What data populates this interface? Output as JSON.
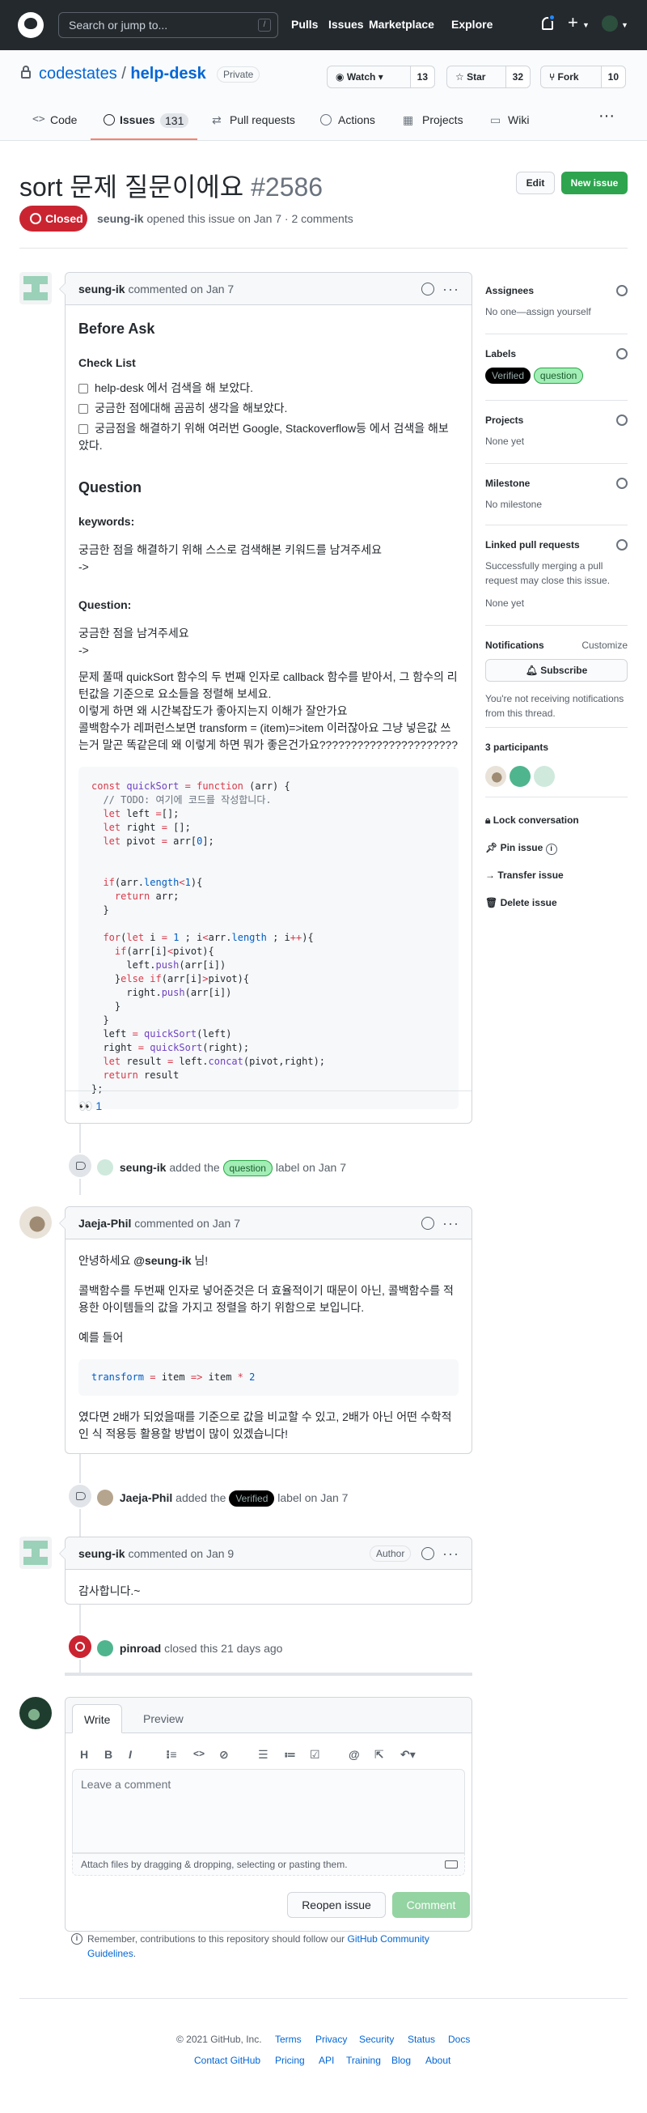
{
  "header": {
    "search_placeholder": "Search or jump to...",
    "slash_key": "/",
    "nav": [
      "Pulls",
      "Issues",
      "Marketplace",
      "Explore"
    ],
    "plus": "+"
  },
  "repo": {
    "owner": "codestates",
    "separator": "/",
    "name": "help-desk",
    "visibility": "Private",
    "watch_label": "Watch",
    "watch_count": "13",
    "star_label": "Star",
    "star_count": "32",
    "fork_label": "Fork",
    "fork_count": "10"
  },
  "tabs": [
    {
      "label": "Code"
    },
    {
      "label": "Issues",
      "count": "131"
    },
    {
      "label": "Pull requests"
    },
    {
      "label": "Actions"
    },
    {
      "label": "Projects"
    },
    {
      "label": "Wiki"
    }
  ],
  "issue": {
    "title": "sort 문제 질문이에요",
    "number": "#2586",
    "edit_label": "Edit",
    "new_issue_label": "New issue",
    "state": "Closed",
    "author": "seung-ik",
    "meta_text": "opened this issue on Jan 7 · 2 comments"
  },
  "comment1": {
    "author": "seung-ik",
    "meta": "commented on Jan 7",
    "h_before": "Before Ask",
    "h_checklist": "Check List",
    "checks": [
      "help-desk 에서 검색을 해 보았다.",
      "궁금한 점에대해 곰곰히 생각을 해보았다.",
      "궁금점을 해결하기 위해 여러번 Google, Stackoverflow등 에서 검색을 해보았다."
    ],
    "h_question": "Question",
    "h_keywords": "keywords:",
    "keywords_text": "궁금한 점을 해결하기 위해 스스로 검색해본 키워드를 남겨주세요",
    "arrow1": "->",
    "h_question2": "Question:",
    "question_text": "궁금한 점을 남겨주세요",
    "arrow2": "->",
    "body_lines": [
      "문제 풀때 quickSort 함수의 두 번째 인자로 callback 함수를 받아서, 그 함수의 리턴값을 기준으로 요소들을 정렬해 보세요.",
      "이렇게 하면 왜 시간복잡도가 좋아지는지 이해가 잘안가요",
      "콜백함수가 레퍼런스보면 transform = (item)=>item 이러잖아요 그냥 넣은값 쓰는거 말곤 똑같은데 왜 이렇게 하면 뭐가 좋은건가요??????????????????????"
    ],
    "reaction_emoji": "👀",
    "reaction_count": "1"
  },
  "event1": {
    "actor": "seung-ik",
    "text_before": "added the",
    "label": "question",
    "text_after": "label on Jan 7"
  },
  "comment2": {
    "author": "Jaeja-Phil",
    "meta": "commented on Jan 7",
    "greeting_pre": "안녕하세요",
    "mention": "@seung-ik",
    "greeting_post": "님!",
    "p1": "콜백함수를 두번째 인자로 넣어준것은 더 효율적이기 때문이 아닌, 콜백함수를 적용한 아이템들의 값을 가지고 정렬을 하기 위함으로 보입니다.",
    "p2": "예를 들어",
    "p3": "였다면 2배가 되었을때를 기준으로 값을 비교할 수 있고, 2배가 아닌 어떤 수학적인 식 적용등 활용할 방법이 많이 있겠습니다!"
  },
  "event2": {
    "actor": "Jaeja-Phil",
    "text_before": "added the",
    "label": "Verified",
    "text_after": "label on Jan 7"
  },
  "comment3": {
    "author": "seung-ik",
    "meta": "commented on Jan 9",
    "badge": "Author",
    "body": "감사합니다.~"
  },
  "event3": {
    "actor": "pinroad",
    "text": "closed this 21 days ago"
  },
  "editor": {
    "tab_write": "Write",
    "tab_preview": "Preview",
    "toolbar": [
      "H",
      "B",
      "I"
    ],
    "placeholder": "Leave a comment",
    "attach": "Attach files by dragging & dropping, selecting or pasting them.",
    "reopen_label": "Reopen issue",
    "comment_label": "Comment"
  },
  "remember": {
    "text": "Remember, contributions to this repository should follow our",
    "link": "GitHub Community Guidelines",
    "end": "."
  },
  "sidebar": {
    "assignees_h": "Assignees",
    "assignees_t": "No one—assign yourself",
    "labels_h": "Labels",
    "labels": [
      "Verified",
      "question"
    ],
    "projects_h": "Projects",
    "projects_t": "None yet",
    "milestone_h": "Milestone",
    "milestone_t": "No milestone",
    "linked_h": "Linked pull requests",
    "linked_t": "Successfully merging a pull request may close this issue.",
    "linked_t2": "None yet",
    "notif_h": "Notifications",
    "notif_customize": "Customize",
    "subscribe": "Subscribe",
    "notif_t": "You're not receiving notifications from this thread.",
    "participants_h": "3 participants",
    "lock": "Lock conversation",
    "pin": "Pin issue",
    "transfer": "Transfer issue",
    "delete": "Delete issue"
  },
  "footer": {
    "copyright": "© 2021 GitHub, Inc.",
    "row1": [
      "Terms",
      "Privacy",
      "Security",
      "Status",
      "Docs"
    ],
    "row2": [
      "Contact GitHub",
      "Pricing",
      "API",
      "Training",
      "Blog",
      "About"
    ]
  },
  "colors": {
    "closed": "#cb2431",
    "green": "#2ea44f",
    "link": "#0366d6"
  }
}
